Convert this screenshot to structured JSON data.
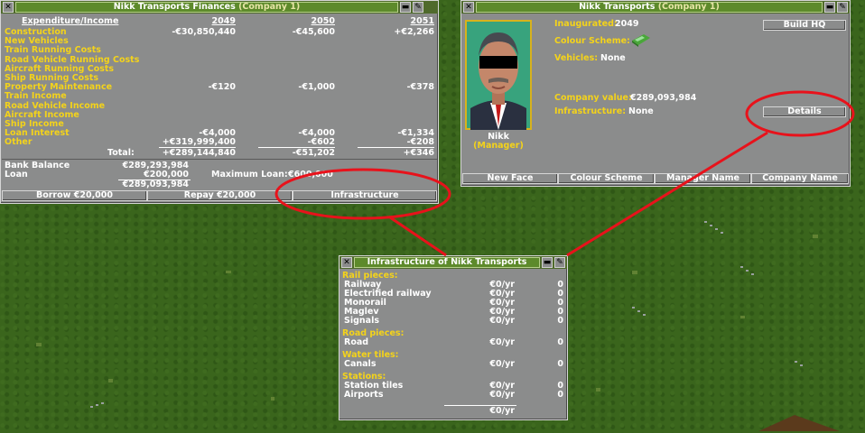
{
  "finances": {
    "title": "Nikk Transports Finances",
    "title_sub": "(Company 1)",
    "header_label": "Expenditure/Income",
    "years": [
      "2049",
      "2050",
      "2051"
    ],
    "rows": [
      {
        "label": "Construction",
        "values": [
          "-€30,850,440",
          "-€45,600",
          "+€2,266"
        ]
      },
      {
        "label": "New Vehicles",
        "values": [
          "",
          "",
          ""
        ]
      },
      {
        "label": "Train Running Costs",
        "values": [
          "",
          "",
          ""
        ]
      },
      {
        "label": "Road Vehicle Running Costs",
        "values": [
          "",
          "",
          ""
        ]
      },
      {
        "label": "Aircraft Running Costs",
        "values": [
          "",
          "",
          ""
        ]
      },
      {
        "label": "Ship Running Costs",
        "values": [
          "",
          "",
          ""
        ]
      },
      {
        "label": "Property Maintenance",
        "values": [
          "-€120",
          "-€1,000",
          "-€378"
        ]
      },
      {
        "label": "Train Income",
        "values": [
          "",
          "",
          ""
        ]
      },
      {
        "label": "Road Vehicle Income",
        "values": [
          "",
          "",
          ""
        ]
      },
      {
        "label": "Aircraft Income",
        "values": [
          "",
          "",
          ""
        ]
      },
      {
        "label": "Ship Income",
        "values": [
          "",
          "",
          ""
        ]
      },
      {
        "label": "Loan Interest",
        "values": [
          "-€4,000",
          "-€4,000",
          "-€1,334"
        ]
      },
      {
        "label": "Other",
        "values": [
          "+€319,999,400",
          "-€602",
          "-€208"
        ]
      }
    ],
    "total_label": "Total:",
    "totals": [
      "+€289,144,840",
      "-€51,202",
      "+€346"
    ],
    "bank_balance_label": "Bank Balance",
    "bank_balance": "€289,293,984",
    "loan_label": "Loan",
    "loan": "€200,000",
    "net": "€289,093,984",
    "max_loan_label": "Maximum Loan:",
    "max_loan": "€600,000",
    "buttons": {
      "borrow": "Borrow €20,000",
      "repay": "Repay €20,000",
      "infrastructure": "Infrastructure"
    }
  },
  "company": {
    "title": "Nikk Transports",
    "title_sub": "(Company 1)",
    "inaugurated_label": "Inaugurated:",
    "inaugurated": "2049",
    "colour_scheme_label": "Colour Scheme:",
    "vehicles_label": "Vehicles:",
    "vehicles": "None",
    "company_value_label": "Company value:",
    "company_value": "€289,093,984",
    "infrastructure_label": "Infrastructure:",
    "infrastructure": "None",
    "manager_name": "Nikk",
    "manager_role": "(Manager)",
    "buttons": {
      "build_hq": "Build HQ",
      "details": "Details",
      "new_face": "New Face",
      "colour_scheme": "Colour Scheme",
      "manager_name": "Manager Name",
      "company_name": "Company Name"
    }
  },
  "infrastructure": {
    "title": "Infrastructure of Nikk Transports",
    "sections": [
      {
        "heading": "Rail pieces:",
        "items": [
          {
            "label": "Railway",
            "cost": "€0/yr",
            "count": "0"
          },
          {
            "label": "Electrified railway",
            "cost": "€0/yr",
            "count": "0"
          },
          {
            "label": "Monorail",
            "cost": "€0/yr",
            "count": "0"
          },
          {
            "label": "Maglev",
            "cost": "€0/yr",
            "count": "0"
          },
          {
            "label": "Signals",
            "cost": "€0/yr",
            "count": "0"
          }
        ]
      },
      {
        "heading": "Road pieces:",
        "items": [
          {
            "label": "Road",
            "cost": "€0/yr",
            "count": "0"
          }
        ]
      },
      {
        "heading": "Water tiles:",
        "items": [
          {
            "label": "Canals",
            "cost": "€0/yr",
            "count": "0"
          }
        ]
      },
      {
        "heading": "Stations:",
        "items": [
          {
            "label": "Station tiles",
            "cost": "€0/yr",
            "count": "0"
          },
          {
            "label": "Airports",
            "cost": "€0/yr",
            "count": "0"
          }
        ]
      }
    ],
    "total": "€0/yr"
  },
  "colors": {
    "label_yellow": "#f4d31a",
    "title_green": "#5d8a2b",
    "panel_gray": "#8b8c8c",
    "annotation_red": "#e8121b"
  }
}
